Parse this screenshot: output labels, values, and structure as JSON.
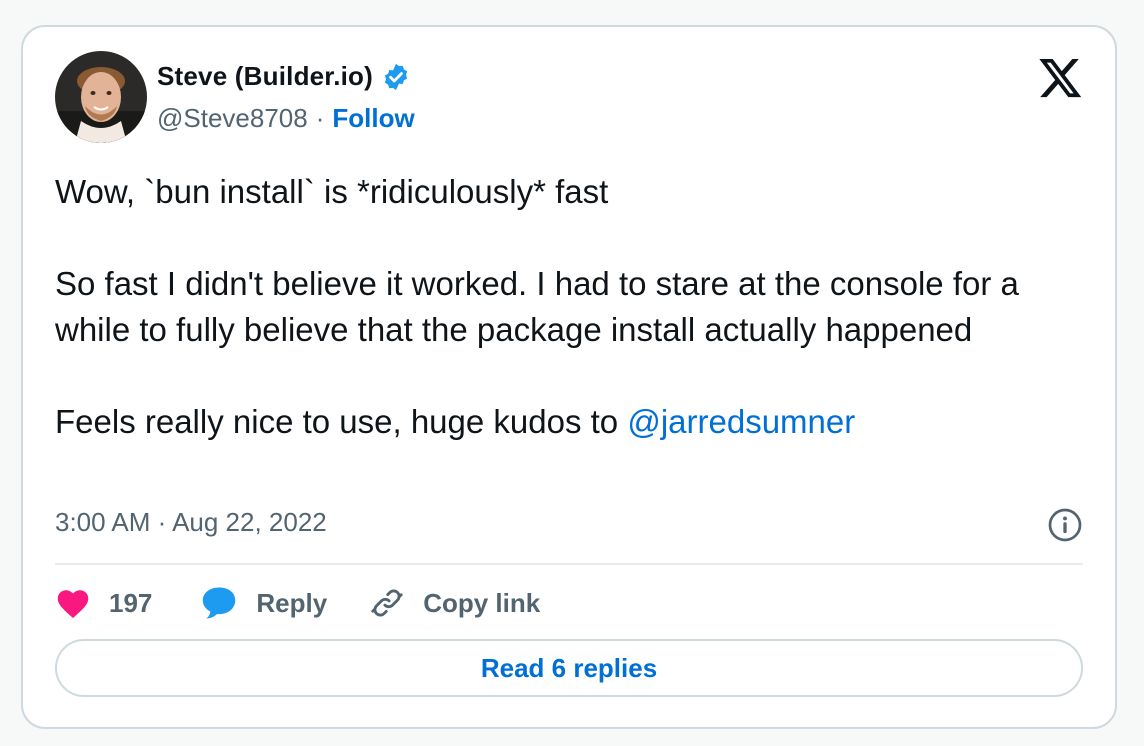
{
  "author": {
    "display_name": "Steve (Builder.io)",
    "handle": "@Steve8708",
    "separator": "·",
    "follow_label": "Follow",
    "verified": true
  },
  "icons": {
    "brand": "x-logo-icon",
    "verified": "verified-badge-icon",
    "info": "info-icon",
    "like": "heart-icon",
    "reply": "speech-bubble-icon",
    "copy_link": "link-icon"
  },
  "colors": {
    "accent": "#006fd6",
    "verified": "#1d9bf0",
    "like": "#f91880",
    "text": "#0f1419",
    "muted": "#536471"
  },
  "tweet": {
    "line1": "Wow, `bun install` is *ridiculously* fast",
    "line2": "So fast I didn't believe it worked. I had to stare at the console for a while to fully believe that the package install actually happened",
    "line3_prefix": "Feels really nice to use, huge kudos to ",
    "mention": "@jarredsumner"
  },
  "meta": {
    "timestamp": "3:00 AM · Aug 22, 2022"
  },
  "actions": {
    "like_count": "197",
    "reply_label": "Reply",
    "copy_link_label": "Copy link"
  },
  "read_replies_label": "Read 6 replies"
}
